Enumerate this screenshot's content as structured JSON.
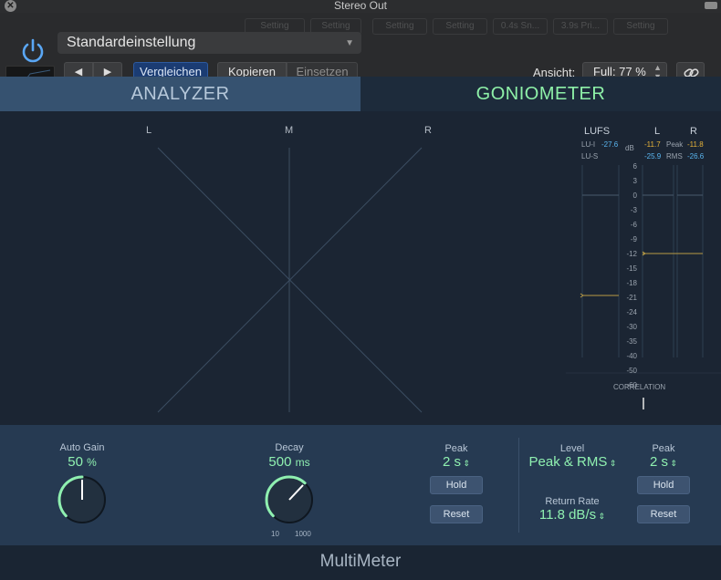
{
  "window": {
    "title": "Stereo Out"
  },
  "header": {
    "preset": "Standardeinstellung",
    "compare_label": "Vergleichen",
    "copy_label": "Kopieren",
    "paste_label": "Einsetzen",
    "view_label": "Ansicht:",
    "view_value": "Full: 77 %",
    "ghost_slots": [
      "Setting",
      "Setting",
      "Setting",
      "Setting",
      "0.4s Sn...",
      "3.9s Pri...",
      "Setting"
    ]
  },
  "tabs": [
    {
      "label": "ANALYZER",
      "active": false
    },
    {
      "label": "GONIOMETER",
      "active": true
    }
  ],
  "goniometer": {
    "labels": [
      "L",
      "M",
      "R"
    ]
  },
  "meters": {
    "lufs_label": "LUFS",
    "lu_i_label": "LU-I",
    "lu_i_value": "-27.6",
    "lu_s_label": "LU-S",
    "db_label": "dB",
    "l_label": "L",
    "r_label": "R",
    "peak_label": "Peak",
    "rms_label": "RMS",
    "peak_l": "-11.7",
    "peak_r": "-11.8",
    "rms_l": "-25.9",
    "rms_r": "-26.6",
    "scale": [
      "6",
      "3",
      "0",
      "-3",
      "-6",
      "-9",
      "-12",
      "-15",
      "-18",
      "-21",
      "-24",
      "-30",
      "-35",
      "-40",
      "-50",
      "-60"
    ],
    "correlation_label": "CORRELATION"
  },
  "controls": {
    "auto_gain": {
      "label": "Auto Gain",
      "value": "50",
      "unit": "%",
      "level": 0.5
    },
    "decay": {
      "label": "Decay",
      "value": "500",
      "unit": "ms",
      "min_label": "10",
      "max_label": "1000",
      "level": 0.66
    },
    "peak_left": {
      "label": "Peak",
      "value": "2 s",
      "hold": "Hold",
      "reset": "Reset"
    },
    "level": {
      "label": "Level",
      "value": "Peak & RMS"
    },
    "return_rate": {
      "label": "Return Rate",
      "value": "11.8 dB/s"
    },
    "peak_right": {
      "label": "Peak",
      "value": "2 s",
      "hold": "Hold",
      "reset": "Reset"
    }
  },
  "footer": {
    "name": "MultiMeter"
  },
  "colors": {
    "accent": "#8ef0a8",
    "tab_active_bg": "#1d2b3b",
    "tab_inactive_bg": "#365270",
    "compare_bg": "#1b3c73",
    "power_blue": "#5aa7f5"
  }
}
